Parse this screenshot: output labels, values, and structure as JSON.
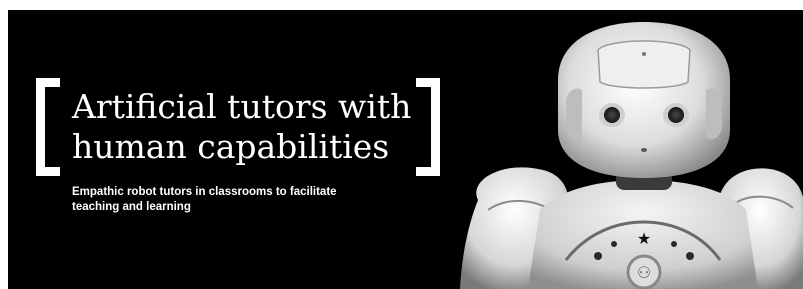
{
  "headline": {
    "line1": "Artificial tutors with",
    "line2": "human capabilities"
  },
  "subtitle": {
    "line1": "Empathic robot tutors in classrooms to facilitate",
    "line2": "teaching and learning"
  },
  "colors": {
    "background": "#000000",
    "text": "#ffffff",
    "robot_body": "#e8e8e8",
    "robot_shadow": "#9a9a9a"
  }
}
